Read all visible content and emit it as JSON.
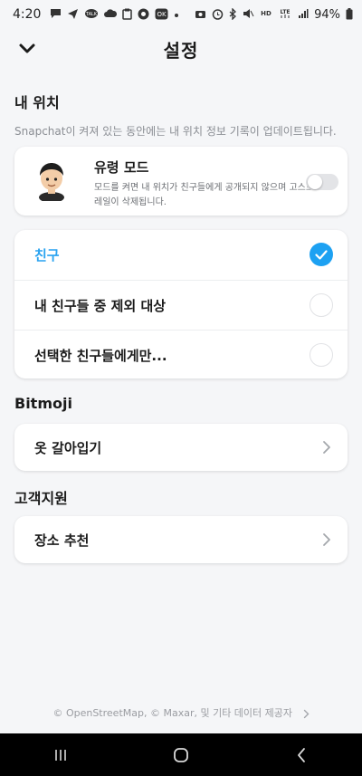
{
  "status_bar": {
    "time": "4:20",
    "battery": "94%",
    "left_icons": [
      "message-icon",
      "send-icon",
      "talk-icon",
      "cloud-icon",
      "clipboard-icon",
      "chat-icon",
      "ok-icon"
    ],
    "right_icons": [
      "camera-icon",
      "alarm-icon",
      "bluetooth-icon",
      "mute-icon",
      "hd-icon",
      "lte-icon",
      "signal-icon"
    ]
  },
  "header": {
    "title": "설정",
    "back_icon": "chevron-down-icon"
  },
  "my_location": {
    "title": "내 위치",
    "description": "Snapchat이 켜져 있는 동안에는 내 위치 정보 기록이 업데이트됩니다."
  },
  "ghost_mode": {
    "title": "유령 모드",
    "description": "모드를 켜면 내 위치가 친구들에게 공개되지 않으며 고스트 트레일이 삭제됩니다.",
    "enabled": false
  },
  "share_options": [
    {
      "label": "친구",
      "selected": true
    },
    {
      "label": "내 친구들 중 제외 대상",
      "selected": false
    },
    {
      "label": "선택한 친구들에게만...",
      "selected": false
    }
  ],
  "bitmoji": {
    "title": "Bitmoji",
    "item_label": "옷 갈아입기"
  },
  "support": {
    "title": "고객지원",
    "item_label": "장소 추천"
  },
  "footer": {
    "text": "© OpenStreetMap, © Maxar, 및 기타 데이터 제공자"
  },
  "colors": {
    "accent": "#1da1f2",
    "background": "#f5f6f8"
  }
}
